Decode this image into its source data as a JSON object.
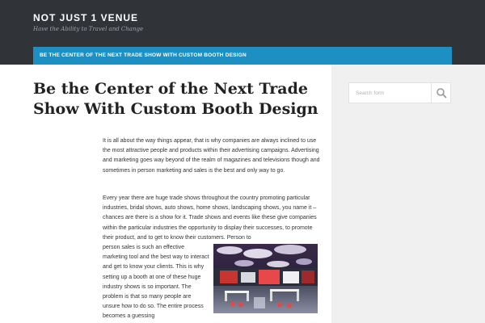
{
  "site": {
    "title": "NOT JUST 1 VENUE",
    "tagline": "Have the Ability to Travel and Change"
  },
  "nav": {
    "items": [
      {
        "label": "BE THE CENTER OF THE NEXT TRADE SHOW WITH CUSTOM BOOTH DESIGN"
      }
    ]
  },
  "search": {
    "placeholder": "Search form",
    "icon": "search-icon"
  },
  "post": {
    "title": "Be the Center of the Next Trade Show With Custom Booth Design",
    "paragraphs": [
      "It is all about the way things appear, that is why companies are always inclined to use the most attractive people and products within their advertising campaigns. Advertising and marketing goes way beyond of the realm of magazines and televisions though and sometimes in person marketing and sales is the best and only way to go.",
      "Every year there are huge trade shows throughout the country promoting particular industries, bridal shows, auto shows, home shows, landscaping shows, you name it – chances are there is a show for it. Trade shows and events like these give companies within the particular industries the opportunity to display their successes, to promote their product, and to get to know their customers. Person to",
      "person sales is such an effective marketing tool and the best way to interact and get to know your clients. This is why setting up a booth at one of these huge industry shows is so important. The problem is that so many people are unsure how to do so. The entire process becomes a guessing"
    ]
  },
  "colors": {
    "header": "#303338",
    "nav": "#1e8fc3",
    "content_bg": "#ffffff",
    "sidebar_bg": "#f0f0f0"
  }
}
